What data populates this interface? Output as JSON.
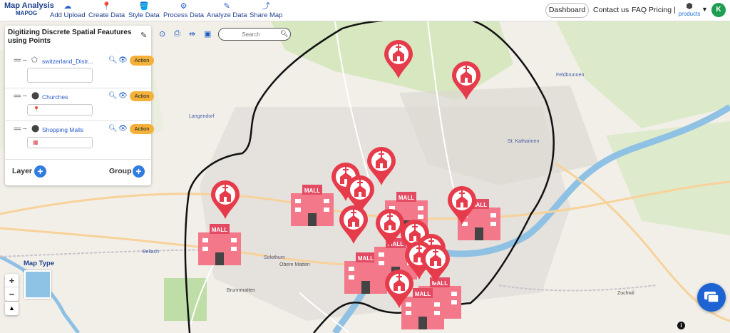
{
  "brand": {
    "title": "Map Analysis",
    "subtitle": "MAPOG"
  },
  "toolbar": {
    "add_upload": "Add Upload",
    "create_data": "Create Data",
    "style_data": "Style Data",
    "process_data": "Process Data",
    "analyze_data": "Analyze Data",
    "share_map": "Share Map"
  },
  "nav": {
    "dashboard": "Dashboard",
    "contact": "Contact us",
    "faq": "FAQ",
    "pricing": "Pricing |",
    "products": "products",
    "user_initial": "K"
  },
  "panel": {
    "title": "Digitizing Discrete Spatial Feautures using Points",
    "layers": [
      {
        "name": "switzerland_Distr...",
        "action": "Action",
        "icon": "polygon-icon"
      },
      {
        "name": "Churches",
        "action": "Action",
        "icon": "location-pin-icon"
      },
      {
        "name": "Shopping Malls",
        "action": "Action",
        "icon": "location-pin-icon"
      }
    ],
    "layer_label": "Layer",
    "group_label": "Group"
  },
  "search": {
    "placeholder": "Search"
  },
  "map": {
    "map_type_label": "Map Type",
    "place_labels": [
      "Langendorf",
      "Bellach",
      "Solothurn",
      "Feldbrunnen",
      "Obere Matten",
      "St. Katharinen",
      "Zuchwil",
      "Brunnmatten"
    ],
    "marker_label_mall": "MALL",
    "colors": {
      "pin": "#e63b4b",
      "mall": "#f2788a",
      "boundary": "#111111",
      "river": "#7fb6dd"
    }
  }
}
